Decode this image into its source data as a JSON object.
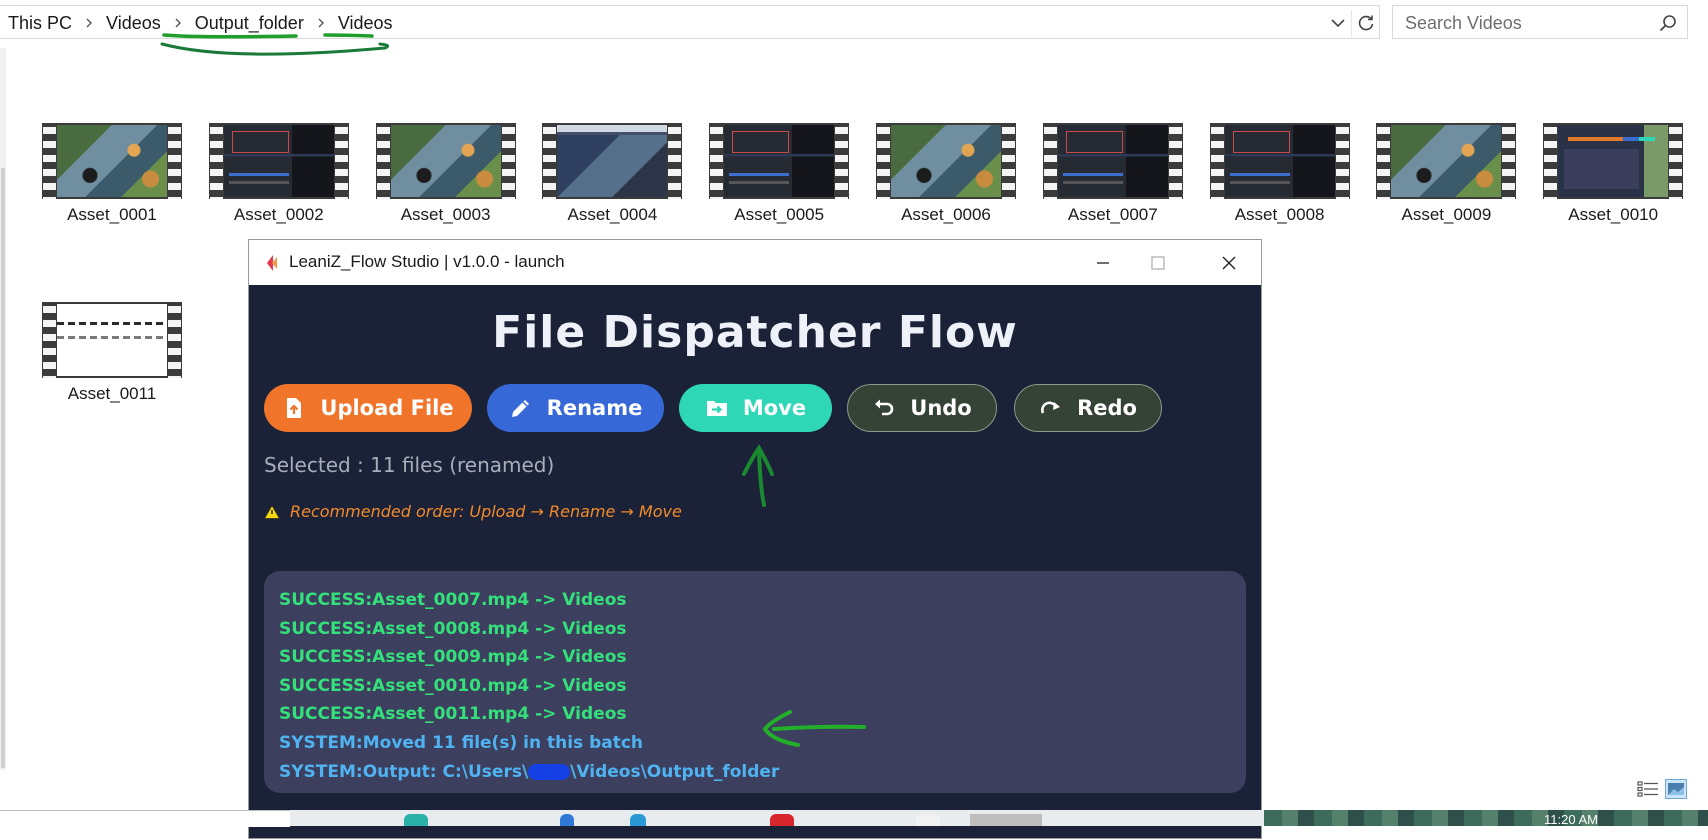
{
  "explorer": {
    "breadcrumbs": [
      "This PC",
      "Videos",
      "Output_folder",
      "Videos"
    ],
    "search_placeholder": "Search Videos",
    "files": [
      {
        "name": "Asset_0001",
        "thumb": "garden"
      },
      {
        "name": "Asset_0002",
        "thumb": "dark"
      },
      {
        "name": "Asset_0003",
        "thumb": "garden"
      },
      {
        "name": "Asset_0004",
        "thumb": "mixed"
      },
      {
        "name": "Asset_0005",
        "thumb": "dark"
      },
      {
        "name": "Asset_0006",
        "thumb": "garden"
      },
      {
        "name": "Asset_0007",
        "thumb": "dark"
      },
      {
        "name": "Asset_0008",
        "thumb": "dark"
      },
      {
        "name": "Asset_0009",
        "thumb": "garden"
      },
      {
        "name": "Asset_0010",
        "thumb": "app"
      },
      {
        "name": "Asset_0011",
        "thumb": "doc"
      }
    ]
  },
  "app": {
    "window_title": "LeaniZ_Flow Studio | v1.0.0 - launch",
    "heading": "File Dispatcher Flow",
    "buttons": {
      "upload": "Upload File",
      "rename": "Rename",
      "move": "Move",
      "undo": "Undo",
      "redo": "Redo"
    },
    "selected_text": "Selected : 11 files (renamed)",
    "recommendation": "Recommended order: Upload → Rename → Move",
    "log": [
      {
        "type": "success",
        "text": "SUCCESS:Asset_0007.mp4 -> Videos"
      },
      {
        "type": "success",
        "text": "SUCCESS:Asset_0008.mp4 -> Videos"
      },
      {
        "type": "success",
        "text": "SUCCESS:Asset_0009.mp4 -> Videos"
      },
      {
        "type": "success",
        "text": "SUCCESS:Asset_0010.mp4 -> Videos"
      },
      {
        "type": "success",
        "text": "SUCCESS:Asset_0011.mp4 -> Videos"
      },
      {
        "type": "system",
        "text": "SYSTEM:Moved 11 file(s) in this batch"
      }
    ],
    "output_line": {
      "prefix": "SYSTEM:Output: C:\\Users\\",
      "suffix": "\\Videos\\Output_folder"
    },
    "colors": {
      "background": "#1b2238",
      "upload": "#f0752a",
      "rename": "#3768d8",
      "move": "#2ed7b6",
      "history": "#354336",
      "success": "#34e07a",
      "system": "#4fb3f2",
      "annotation": "#1f9e2e"
    }
  },
  "taskbar": {
    "clock": "11:20 AM"
  }
}
